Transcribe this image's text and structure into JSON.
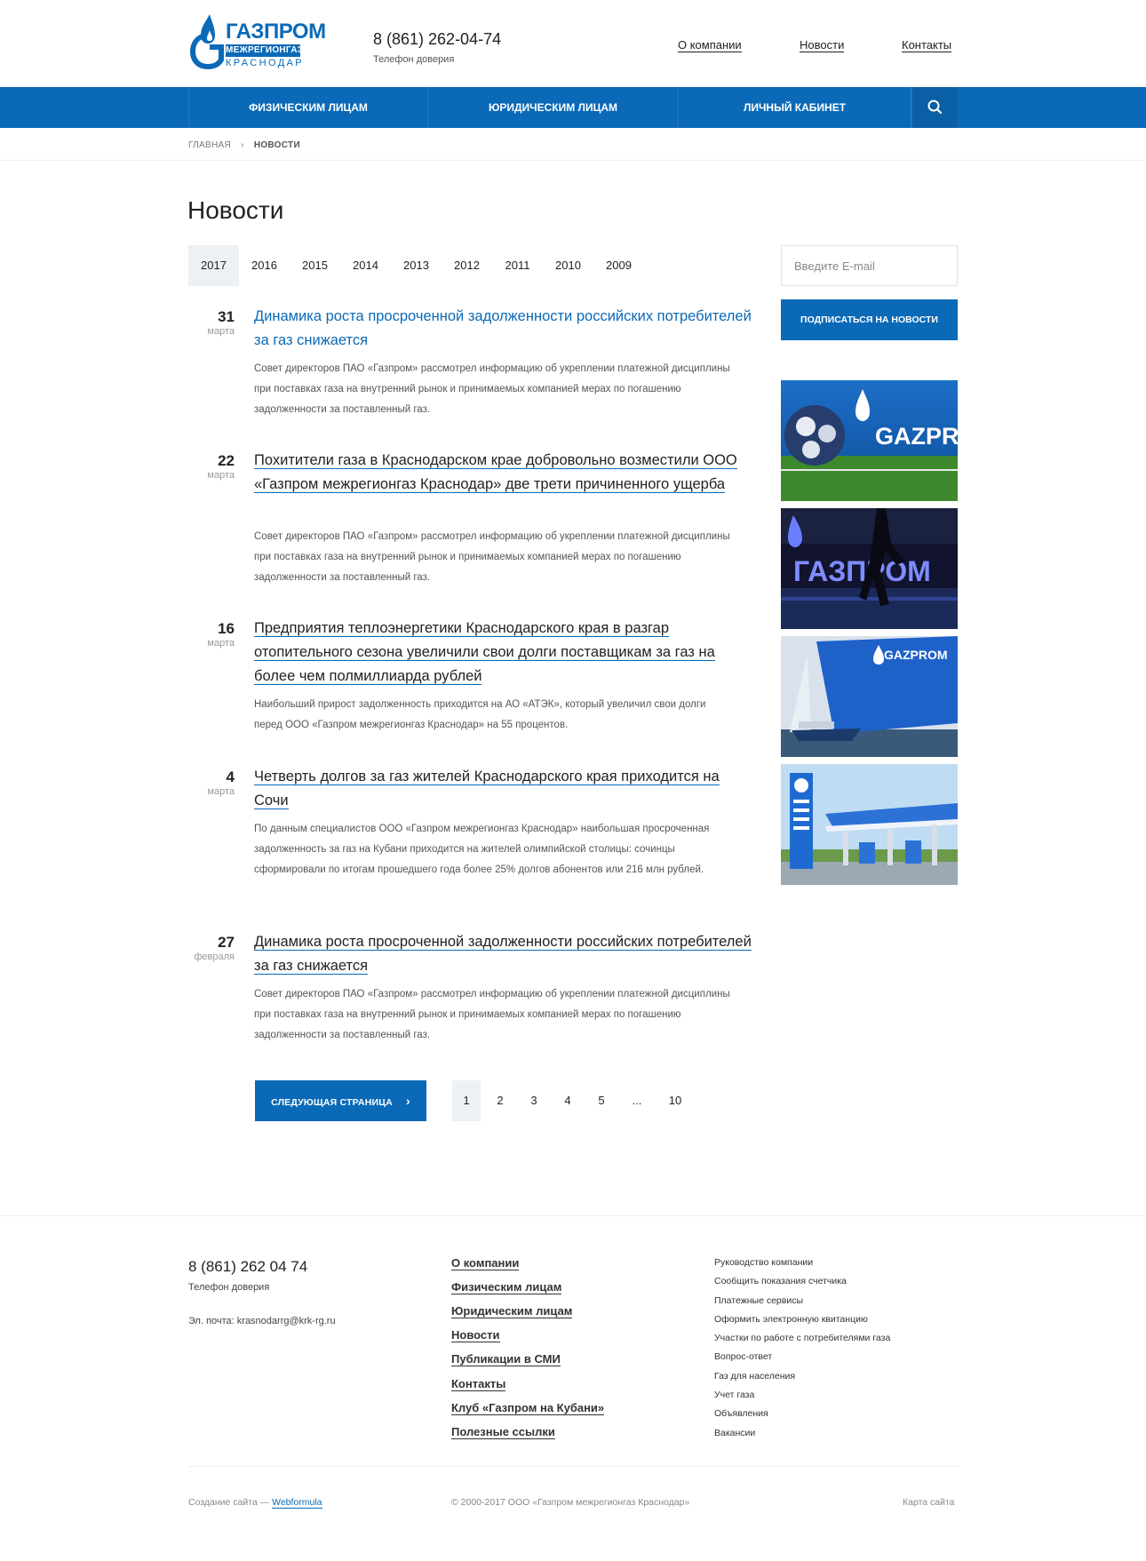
{
  "logo": {
    "line1": "ГАЗПРОМ",
    "line2": "МЕЖРЕГИОНГАЗ",
    "line3": "КРАСНОДАР"
  },
  "header": {
    "phone": "8 (861) 262-04-74",
    "phone_caption": "Телефон доверия",
    "links": [
      "О компании",
      "Новости",
      "Контакты"
    ]
  },
  "nav": {
    "items": [
      "ФИЗИЧЕСКИМ ЛИЦАМ",
      "ЮРИДИЧЕСКИМ ЛИЦАМ",
      "ЛИЧНЫЙ КАБИНЕТ"
    ],
    "search_icon": "search-icon"
  },
  "breadcrumb": {
    "home": "ГЛАВНАЯ",
    "separator": "›",
    "current": "НОВОСТИ"
  },
  "page_title": "Новости",
  "years": [
    "2017",
    "2016",
    "2015",
    "2014",
    "2013",
    "2012",
    "2011",
    "2010",
    "2009"
  ],
  "active_year": "2017",
  "news": [
    {
      "day": "31",
      "month": "марта",
      "title": "Динамика роста просроченной задолженности российских потребителей за газ снижается",
      "text": "Совет директоров ПАО «Газпром» рассмотрел информацию об укреплении платежной дисциплины при поставках газа на внутренний рынок и принимаемых компанией мерах по погашению задолженности за поставленный газ."
    },
    {
      "day": "22",
      "month": "марта",
      "title": "Похитители газа в Краснодарском крае добровольно возместили ООО «Газпром межрегионгаз Краснодар» две трети причиненного ущерба",
      "text": "Совет директоров ПАО «Газпром» рассмотрел информацию об укреплении платежной дисциплины при поставках газа на внутренний рынок и принимаемых компанией мерах по погашению задолженности за поставленный газ."
    },
    {
      "day": "16",
      "month": "марта",
      "title": "Предприятия теплоэнергетики Краснодарского края в разгар отопительного сезона увеличили свои долги поставщикам за газ на более чем полмиллиарда рублей",
      "text": "Наибольший прирост задолженность приходится на АО «АТЭК», который увеличил свои долги перед ООО «Газпром межрегионгаз Краснодар» на 55 процентов."
    },
    {
      "day": "4",
      "month": "марта",
      "title": "Четверть долгов за газ жителей Краснодарского края приходится на Сочи",
      "text": "По данным специалистов ООО «Газпром межрегионгаз Краснодар» наибольшая просроченная задолженность за газ на Кубани приходится на жителей олимпийской столицы: сочинцы сформировали по итогам прошедшего года более 25% долгов абонентов или 216 млн рублей."
    },
    {
      "day": "27",
      "month": "февраля",
      "title": "Динамика роста просроченной задолженности российских потребителей за газ снижается",
      "text": "Совет директоров ПАО «Газпром» рассмотрел информацию об укреплении платежной дисциплины при поставках газа на внутренний рынок и принимаемых компанией мерах по погашению задолженности за поставленный газ."
    }
  ],
  "pagination": {
    "next_label": "СЛЕДУЮЩАЯ СТРАНИЦА",
    "next_icon": "›",
    "pages": [
      "1",
      "2",
      "3",
      "4",
      "5",
      "...",
      "10"
    ],
    "active": "1"
  },
  "sidebar": {
    "email_placeholder": "Введите E-mail",
    "subscribe_label": "ПОДПИСАТЬСЯ НА НОВОСТИ",
    "banner_texts": [
      "GAZPROM",
      "ГАЗПРОМ",
      "GAZPROM"
    ]
  },
  "footer": {
    "phone": "8 (861) 262 04 74",
    "phone_caption": "Телефон доверия",
    "email": "Эл. почта: krasnodarrg@krk-rg.ru",
    "links": [
      "О компании",
      "Физическим лицам",
      "Юридическим лицам",
      "Новости",
      "Публикации в СМИ",
      "Контакты",
      "Клуб «Газпром на Кубани»",
      "Полезные ссылки"
    ],
    "small_links": [
      "Руководство компании",
      "Сообщить показания счетчика",
      "Платежные сервисы",
      "Оформить электронную квитанцию",
      "Участки по работе с потребителями газа",
      "Вопрос-ответ",
      "Газ для населения",
      "Учет газа",
      "Объявления",
      "Вакансии"
    ],
    "made_by": "Создание сайта —",
    "made_by_link": "Webformula",
    "copyright": "© 2000-2017 ООО «Газпром межрегионгаз Краснодар»",
    "sitemap": "Карта сайта"
  },
  "colors": {
    "brand": "#0b6ab7",
    "light_bg": "#eef1f4"
  }
}
